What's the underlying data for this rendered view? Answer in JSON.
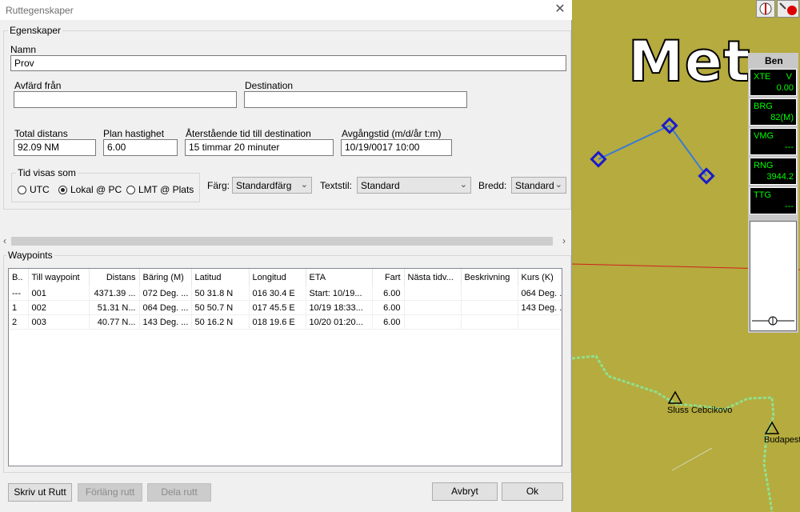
{
  "dialog": {
    "title": "Ruttegenskaper",
    "close_symbol": "✕",
    "properties_group": "Egenskaper",
    "name_label": "Namn",
    "name_value": "Prov",
    "from_label": "Avfärd från",
    "from_value": "",
    "dest_label": "Destination",
    "dest_value": "",
    "total_dist_label": "Total distans",
    "total_dist_value": "92.09 NM",
    "plan_speed_label": "Plan hastighet",
    "plan_speed_value": "6.00",
    "remaining_label": "Återstående tid till destination",
    "remaining_value": "15 timmar 20 minuter",
    "departure_label": "Avgångstid (m/d/år t:m)",
    "departure_value": "10/19/0017 10:00",
    "time_group": "Tid visas som",
    "time_options": [
      "UTC",
      "Lokal @ PC",
      "LMT @ Plats"
    ],
    "time_selected": "Lokal @ PC",
    "color_label": "Färg:",
    "color_value": "Standardfärg",
    "textstyle_label": "Textstil:",
    "textstyle_value": "Standard",
    "width_label": "Bredd:",
    "width_value": "Standard",
    "waypoints_group": "Waypoints",
    "columns": [
      "B..",
      "Till waypoint",
      "Distans",
      "Bäring (M)",
      "Latitud",
      "Longitud",
      "ETA",
      "Fart",
      "Nästa tidv...",
      "Beskrivning",
      "Kurs (K)"
    ],
    "rows": [
      [
        "---",
        "001",
        "4371.39 ...",
        "072 Deg. ...",
        "50 31.8 N",
        "016 30.4 E",
        "Start:  10/19...",
        "6.00",
        "",
        "",
        "064 Deg. ..."
      ],
      [
        "1",
        "002",
        "51.31 N...",
        "064 Deg. ...",
        "50 50.7 N",
        "017 45.5 E",
        "10/19 18:33...",
        "6.00",
        "",
        "",
        "143 Deg. ..."
      ],
      [
        "2",
        "003",
        "40.77 N...",
        "143 Deg. ...",
        "50 16.2 N",
        "018 19.6 E",
        "10/20 01:20...",
        "6.00",
        "",
        "",
        ""
      ]
    ],
    "buttons": {
      "print": "Skriv ut Rutt",
      "extend": "Förläng rutt",
      "split": "Dela rutt",
      "cancel": "Avbryt",
      "ok": "Ok"
    }
  },
  "map": {
    "big_text": "Met",
    "label1": "Sluss Cebcikovo",
    "label2": "Budapest"
  },
  "instruments": {
    "title": "Ben",
    "xte_label": "XTE",
    "xte_unit": "V",
    "xte_value": "0.00",
    "brg_label": "BRG",
    "brg_value": "82(M)",
    "vmg_label": "VMG",
    "vmg_value": "---",
    "rng_label": "RNG",
    "rng_value": "3944.2",
    "ttg_label": "TTG",
    "ttg_value": "---"
  },
  "colors": {
    "map_land": "#b5ab3e",
    "route_line": "#3a7bd5",
    "waypoint": "#1a1acc",
    "instrument_text": "#00ff00"
  }
}
